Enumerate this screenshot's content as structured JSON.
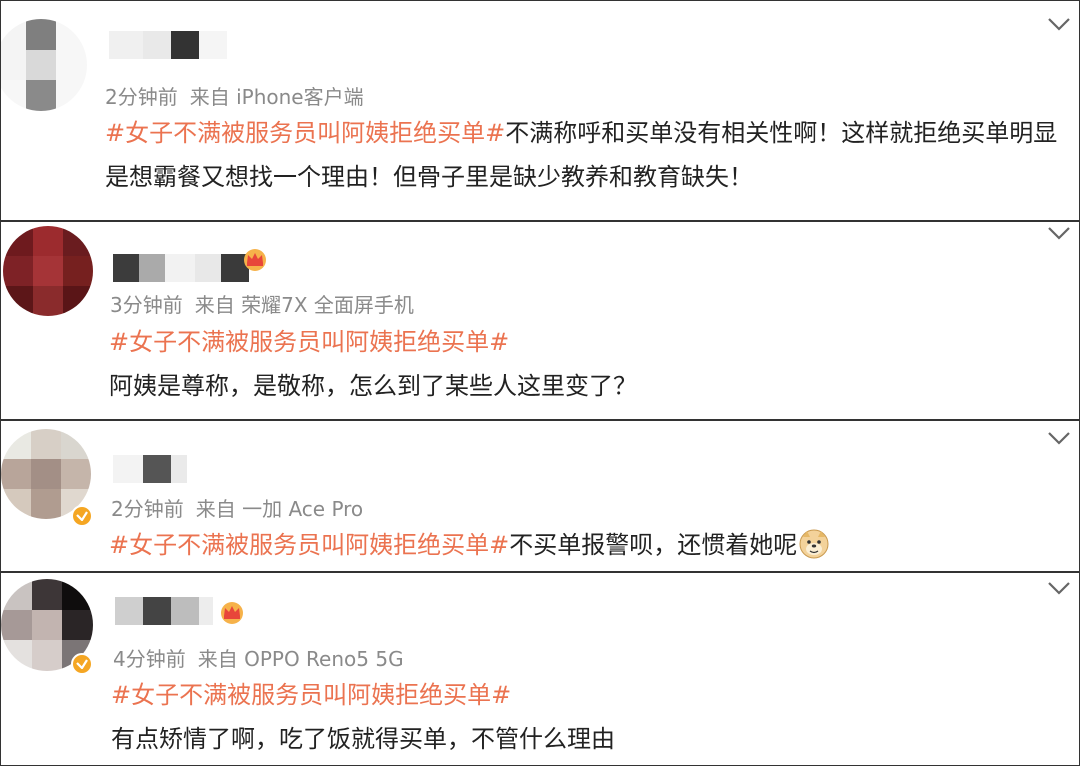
{
  "comments": [
    {
      "time": "2分钟前",
      "source_prefix": "来自",
      "source": "iPhone客户端",
      "hashtag": "#女子不满被服务员叫阿姨拒绝买单#",
      "body": "不满称呼和买单没有相关性啊！这样就拒绝买单明显是想霸餐又想找一个理由！但骨子里是缺少教养和教育缺失！",
      "has_vip_crown": false,
      "verified": false
    },
    {
      "time": "3分钟前",
      "source_prefix": "来自",
      "source": "荣耀7X 全面屏手机",
      "hashtag": "#女子不满被服务员叫阿姨拒绝买单#",
      "body": "阿姨是尊称，是敬称，怎么到了某些人这里变了？",
      "has_vip_crown": true,
      "verified": false
    },
    {
      "time": "2分钟前",
      "source_prefix": "来自",
      "source": "一加 Ace Pro",
      "hashtag": "#女子不满被服务员叫阿姨拒绝买单#",
      "body": "不买单报警呗，还惯着她呢",
      "emoji": "doge-emoji",
      "has_vip_crown": false,
      "verified": true
    },
    {
      "time": "4分钟前",
      "source_prefix": "来自",
      "source": "OPPO Reno5 5G",
      "hashtag": "#女子不满被服务员叫阿姨拒绝买单#",
      "body": "有点矫情了啊，吃了饭就得买单，不管什么理由",
      "has_vip_crown": true,
      "verified": true
    }
  ],
  "colors": {
    "hashtag": "#eb7350",
    "meta": "#8a8a8a",
    "verified_badge": "#f5a623"
  }
}
